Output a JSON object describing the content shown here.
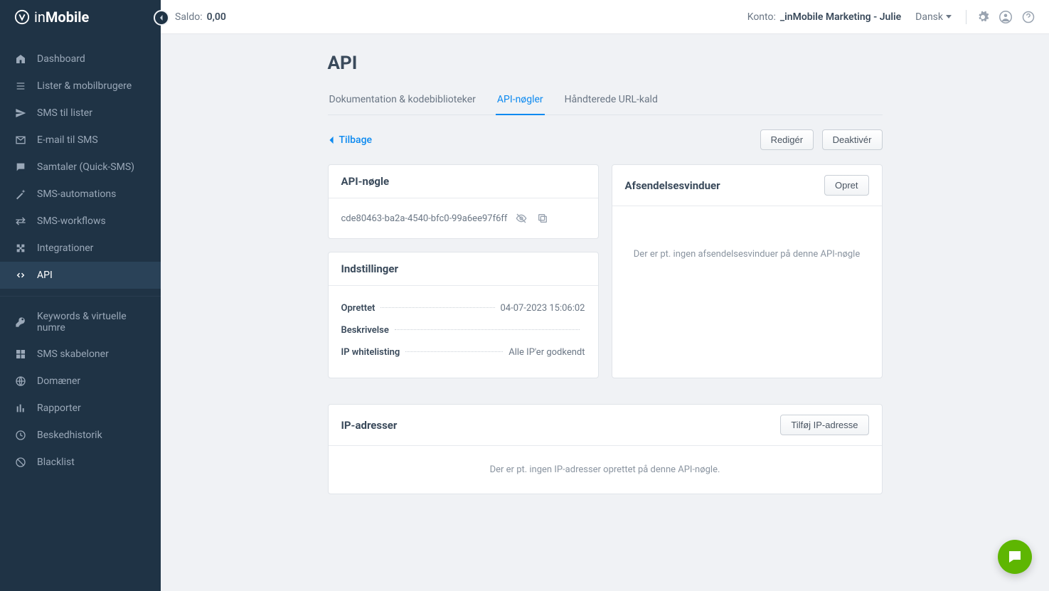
{
  "brand": {
    "prefix": "in",
    "bold": "Mobile"
  },
  "topbar": {
    "saldo_label": "Saldo:",
    "saldo_value": "0,00",
    "konto_label": "Konto:",
    "konto_value": "_inMobile Marketing - Julie",
    "language": "Dansk"
  },
  "sidebar": {
    "items": [
      {
        "label": "Dashboard"
      },
      {
        "label": "Lister & mobilbrugere"
      },
      {
        "label": "SMS til lister"
      },
      {
        "label": "E-mail til SMS"
      },
      {
        "label": "Samtaler (Quick-SMS)"
      },
      {
        "label": "SMS-automations"
      },
      {
        "label": "SMS-workflows"
      },
      {
        "label": "Integrationer"
      },
      {
        "label": "API"
      }
    ],
    "items2": [
      {
        "label": "Keywords & virtuelle numre"
      },
      {
        "label": "SMS skabeloner"
      },
      {
        "label": "Domæner"
      },
      {
        "label": "Rapporter"
      },
      {
        "label": "Beskedhistorik"
      },
      {
        "label": "Blacklist"
      }
    ]
  },
  "page": {
    "title": "API"
  },
  "tabs": {
    "doc": "Dokumentation & kodebiblioteker",
    "keys": "API-nøgler",
    "calls": "Håndterede URL-kald"
  },
  "actions": {
    "back": "Tilbage",
    "edit": "Redigér",
    "deactivate": "Deaktivér",
    "create": "Opret",
    "add_ip": "Tilføj IP-adresse"
  },
  "api_key_card": {
    "title": "API-nøgle",
    "key": "cde80463-ba2a-4540-bfc0-99a6ee97f6ff"
  },
  "settings_card": {
    "title": "Indstillinger",
    "created_label": "Oprettet",
    "created_value": "04-07-2023 15:06:02",
    "desc_label": "Beskrivelse",
    "desc_value": "",
    "ip_label": "IP whitelisting",
    "ip_value": "Alle IP'er godkendt"
  },
  "windows_card": {
    "title": "Afsendelsesvinduer",
    "empty": "Der er pt. ingen afsendelsesvinduer på denne API-nøgle"
  },
  "ip_card": {
    "title": "IP-adresser",
    "empty": "Der er pt. ingen IP-adresser oprettet på denne API-nøgle."
  }
}
